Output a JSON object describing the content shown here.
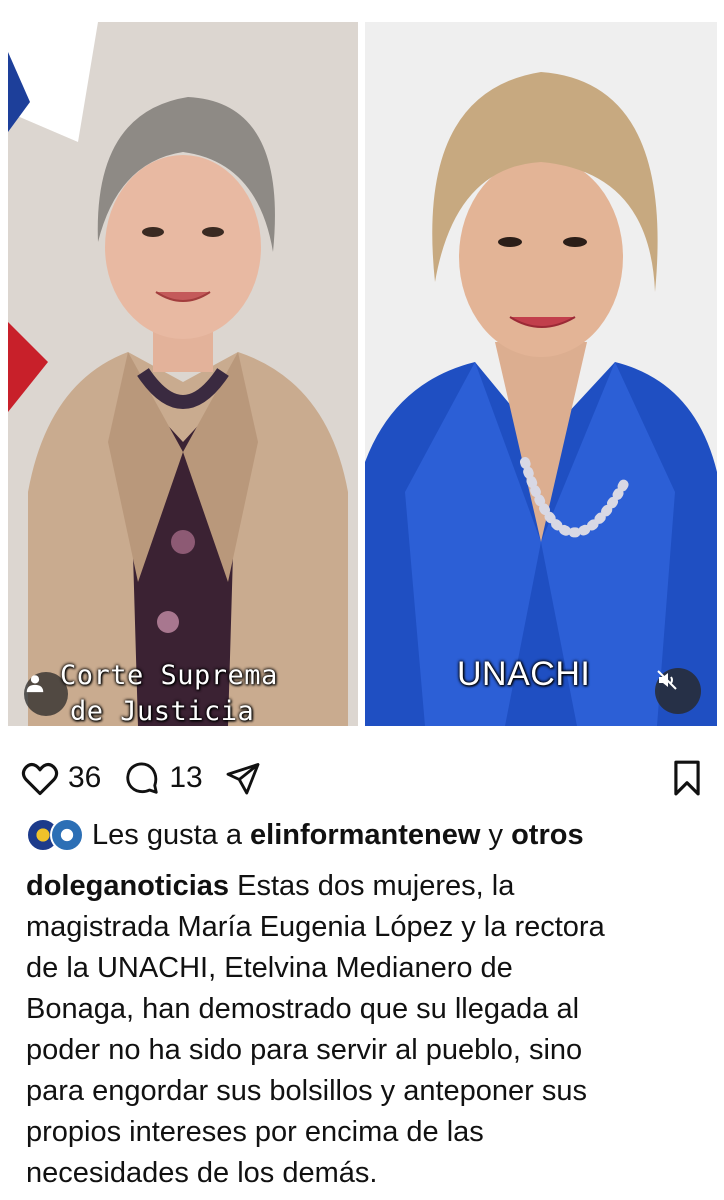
{
  "post": {
    "images": [
      {
        "caption_line1": "Corte Suprema",
        "caption_line2": "de Justicia",
        "has_user_tag": true
      },
      {
        "caption": "UNACHI",
        "has_mute_button": true
      }
    ]
  },
  "actions": {
    "likes_count": "36",
    "comments_count": "13",
    "icons": [
      "heart-icon",
      "comment-icon",
      "share-icon",
      "bookmark-icon"
    ]
  },
  "liked_by": {
    "prefix": "Les gusta a",
    "user": "elinformantenew",
    "connector": "y",
    "others": "otros"
  },
  "caption": {
    "username": "doleganoticias",
    "lines": [
      "Estas dos mujeres, la",
      "magistrada María Eugenia López y la rectora",
      "de la UNACHI, Etelvina Medianero de",
      "Bonaga, han demostrado que su llegada al",
      "poder no ha sido para servir al pueblo, sino",
      "para engordar sus bolsillos y anteponer sus",
      "propios intereses por encima de las",
      "necesidades de los demás."
    ]
  },
  "colors": {
    "blazer_blue": "#1f4fc2",
    "text": "#111111"
  }
}
